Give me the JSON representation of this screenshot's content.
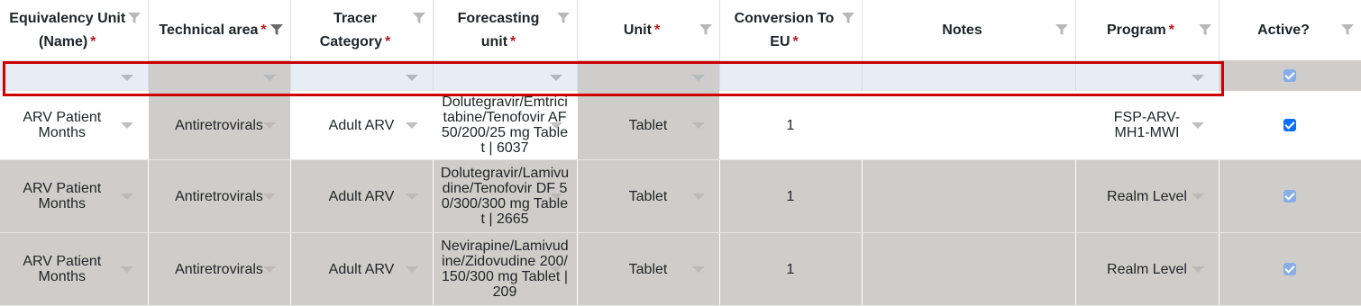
{
  "headers": [
    {
      "label": "Equivalency Unit (Name)",
      "required": true
    },
    {
      "label": "Technical area",
      "required": true
    },
    {
      "label": "Tracer Category",
      "required": true
    },
    {
      "label": "Forecasting unit",
      "required": true
    },
    {
      "label": "Unit",
      "required": true
    },
    {
      "label": "Conversion To EU",
      "required": true
    },
    {
      "label": "Notes",
      "required": false
    },
    {
      "label": "Program",
      "required": true
    },
    {
      "label": "Active?",
      "required": false
    }
  ],
  "required_mark": "*",
  "rows": [
    {
      "equivalency_unit": "ARV Patient Months",
      "technical_area": "Antiretrovirals",
      "tracer_category": "Adult ARV",
      "forecasting_unit": "Dolutegravir/Emtricitabine/Tenofovir AF 50/200/25 mg Tablet | 6037",
      "unit": "Tablet",
      "conversion": "1",
      "notes": "",
      "program": "FSP-ARV-MH1-MWI",
      "active": true
    },
    {
      "equivalency_unit": "ARV Patient Months",
      "technical_area": "Antiretrovirals",
      "tracer_category": "Adult ARV",
      "forecasting_unit": "Dolutegravir/Lamivudine/Tenofovir DF 50/300/300 mg Tablet | 2665",
      "unit": "Tablet",
      "conversion": "1",
      "notes": "",
      "program": "Realm Level",
      "active": true
    },
    {
      "equivalency_unit": "ARV Patient Months",
      "technical_area": "Antiretrovirals",
      "tracer_category": "Adult ARV",
      "forecasting_unit": "Nevirapine/Lamivudine/Zidovudine 200/150/300 mg Tablet | 209",
      "unit": "Tablet",
      "conversion": "1",
      "notes": "",
      "program": "Realm Level",
      "active": true
    }
  ],
  "new_row": {
    "active": true
  },
  "icons": {
    "filter": "filter-icon",
    "dropdown": "dropdown-arrow-icon",
    "checkbox": "checkbox-icon"
  },
  "colors": {
    "required": "#b91c1c",
    "highlight": "#cc0000",
    "checkbox": "#0d6efd",
    "readonly_cell": "#cfcdca"
  }
}
